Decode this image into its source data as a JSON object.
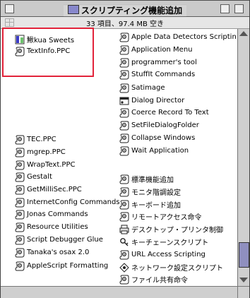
{
  "window": {
    "title": "スクリプティング機能追加"
  },
  "status_bar": {
    "text": "33 項目、97.4 MB 空き"
  },
  "left_column": [
    {
      "label": "鰍kua Sweets",
      "icon": "blue-bar-icon"
    },
    {
      "label": "TextInfo.PPC",
      "icon": "scroll-gear-icon"
    },
    {
      "label": "TEC.PPC",
      "icon": "scroll-gear-icon"
    },
    {
      "label": "mgrep.PPC",
      "icon": "scroll-gear-icon"
    },
    {
      "label": "WrapText.PPC",
      "icon": "scroll-gear-icon"
    },
    {
      "label": "Gestalt",
      "icon": "scroll-gear-icon"
    },
    {
      "label": "GetMilliSec.PPC",
      "icon": "scroll-gear-icon"
    },
    {
      "label": "InternetConfig Commands",
      "icon": "scroll-gear-icon"
    },
    {
      "label": "Jonas Commands",
      "icon": "scroll-gear-icon"
    },
    {
      "label": "Resource Utilities",
      "icon": "scroll-gear-icon"
    },
    {
      "label": "Script Debugger Glue",
      "icon": "scroll-gear-icon"
    },
    {
      "label": "Tanaka's osax 2.0",
      "icon": "scroll-gear-icon"
    },
    {
      "label": "AppleScript Formatting",
      "icon": "scroll-gear-icon"
    }
  ],
  "right_column": [
    {
      "label": "Apple Data Detectors Scripting",
      "icon": "scroll-gear-icon"
    },
    {
      "label": "Application Menu",
      "icon": "scroll-gear-icon"
    },
    {
      "label": "programmer's tool",
      "icon": "scroll-gear-icon"
    },
    {
      "label": "StuffIt Commands",
      "icon": "scroll-gear-icon"
    },
    {
      "label": "Satimage",
      "icon": "scroll-gear-icon"
    },
    {
      "label": "Dialog Director",
      "icon": "dialog-icon"
    },
    {
      "label": "Coerce Record To Text",
      "icon": "scroll-gear-icon"
    },
    {
      "label": "SetFileDialogFolder",
      "icon": "scroll-gear-icon"
    },
    {
      "label": "Collapse Windows",
      "icon": "scroll-gear-icon"
    },
    {
      "label": "Wait Application",
      "icon": "scroll-gear-icon"
    },
    {
      "label": "標準機能追加",
      "icon": "scroll-gear-icon"
    },
    {
      "label": "モニタ階調設定",
      "icon": "scroll-gear-icon"
    },
    {
      "label": "キーボード追加",
      "icon": "scroll-gear-icon"
    },
    {
      "label": "リモートアクセス命令",
      "icon": "scroll-gear-icon"
    },
    {
      "label": "デスクトップ・プリンタ制御",
      "icon": "printer-icon"
    },
    {
      "label": "キーチェーンスクリプト",
      "icon": "keychain-icon"
    },
    {
      "label": "URL Access Scripting",
      "icon": "scroll-gear-icon"
    },
    {
      "label": "ネットワーク設定スクリプト",
      "icon": "network-icon"
    },
    {
      "label": "ファイル共有命令",
      "icon": "scroll-gear-icon"
    }
  ],
  "colors": {
    "highlight": "#e2233a",
    "scroll_thumb": "#8f8fbf"
  }
}
